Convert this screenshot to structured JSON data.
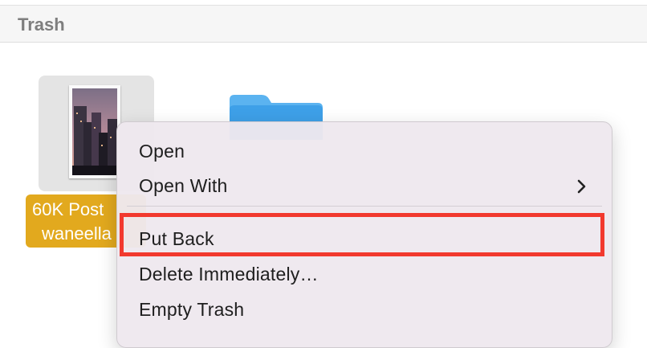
{
  "window": {
    "title": "Trash"
  },
  "file": {
    "name_line1": "60K Post",
    "name_line2": "waneella"
  },
  "context_menu": {
    "items": [
      {
        "label": "Open"
      },
      {
        "label": "Open With",
        "has_submenu": true
      },
      {
        "label": "Put Back",
        "highlighted": true
      },
      {
        "label": "Delete Immediately…"
      },
      {
        "label": "Empty Trash"
      }
    ]
  },
  "colors": {
    "highlight_border": "#f2392e",
    "selection_label": "#e2a91e",
    "folder": "#3ea0e8"
  }
}
